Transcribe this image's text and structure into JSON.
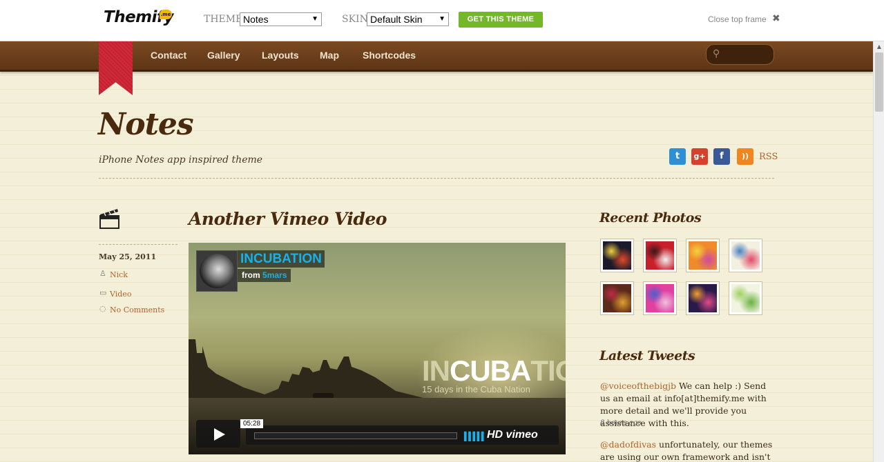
{
  "topframe": {
    "logo": "Themify",
    "logo_badge": ".me",
    "theme_label": "THEME",
    "theme_value": "Notes",
    "skin_label": "SKIN",
    "skin_value": "Default Skin",
    "get_button": "GET THIS THEME",
    "close_label": "Close top frame",
    "close_icon": "close-icon"
  },
  "nav": {
    "items": [
      "Contact",
      "Gallery",
      "Layouts",
      "Map",
      "Shortcodes"
    ],
    "search_icon": "search-icon"
  },
  "site": {
    "title": "Notes",
    "tagline": "iPhone Notes app inspired theme",
    "social": [
      {
        "icon": "twitter-icon",
        "glyph": "t",
        "color": "#2d8fd6"
      },
      {
        "icon": "google-plus-icon",
        "glyph": "g+",
        "color": "#d6412d"
      },
      {
        "icon": "facebook-icon",
        "glyph": "f",
        "color": "#3b5998"
      },
      {
        "icon": "rss-icon",
        "glyph": "))",
        "color": "#f0861d"
      }
    ],
    "rss_label": "RSS"
  },
  "post": {
    "format_icon": "clapperboard-icon",
    "date": "May 25, 2011",
    "author": "Nick",
    "category": "Video",
    "comments": "No Comments",
    "title": "Another Vimeo Video",
    "video": {
      "title": "INCUBATION",
      "from_label": "from",
      "from_user": "5mars",
      "overlay_pre": "IN",
      "overlay_bold": "CUBA",
      "overlay_post": "TION",
      "overlay_sub": "15 days in the Cuba Nation",
      "duration": "05:28",
      "hd_label": "HD vimeo",
      "play_icon": "play-icon"
    }
  },
  "sidebar": {
    "photos_title": "Recent Photos",
    "photos": [
      {
        "colors": [
          "#1a1a2a",
          "#e04a2a",
          "#f2d040"
        ]
      },
      {
        "colors": [
          "#c8202a",
          "#f0f0f0",
          "#3a1a1a"
        ]
      },
      {
        "colors": [
          "#f08a2a",
          "#d04aa0",
          "#f2d040"
        ]
      },
      {
        "colors": [
          "#f4f0e0",
          "#e04a6a",
          "#4a80c0"
        ]
      },
      {
        "colors": [
          "#5a2a1a",
          "#e0a030",
          "#c02a4a"
        ]
      },
      {
        "colors": [
          "#e040a0",
          "#f0c0e0",
          "#4a60d0"
        ]
      },
      {
        "colors": [
          "#2a1a4a",
          "#e04a8a",
          "#f0a030"
        ]
      },
      {
        "colors": [
          "#f0f4e0",
          "#6ab040",
          "#a0d060"
        ]
      }
    ],
    "tweets_title": "Latest Tweets",
    "tweets": [
      {
        "handle": "@voiceofthebigjb",
        "text": " We can help :) Send us an email at info[at]themify.me with more detail and we'll provide you assistance with this.",
        "time": "8 hours ago"
      },
      {
        "handle": "@dadofdivas",
        "text": " unfortunately, our themes are using our own framework and isn't",
        "time": ""
      }
    ]
  },
  "scrollbar": {
    "up_icon": "scroll-up-icon"
  }
}
